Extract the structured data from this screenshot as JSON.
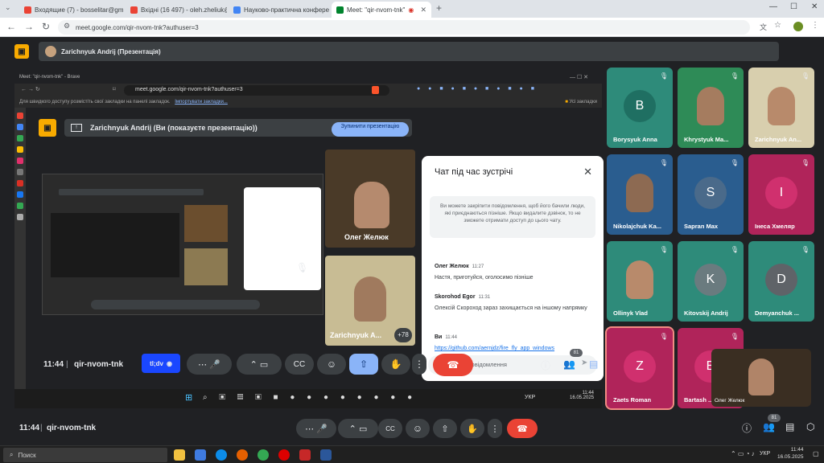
{
  "browser": {
    "tabs": [
      {
        "label": "Входящие (7) - bosselitar@gm"
      },
      {
        "label": "Вхідні (16 497) - oleh.zheliuk@"
      },
      {
        "label": "Науково-практична конфере"
      },
      {
        "label": "Meet: \"qir-nvom-tnk\""
      }
    ],
    "new_tab": "+",
    "url": "meet.google.com/qir-nvom-tnk?authuser=3"
  },
  "presenter_chip": "Zarichnyuk Andrij (Презентація)",
  "shared": {
    "window_title": "Meet: \"qir-nvom-tnk\" - Brave",
    "url": "meet.google.com/qir-nvom-tnk?authuser=3",
    "bookmarks_hint": "Для швидкого доступу розмістіть свої закладки на панелі закладок.",
    "bookmarks_link": "Імпортувати закладки...",
    "bookmarks_folder": "Усі закладки",
    "presenting_text": "Zarichnyuk Andrij (Ви (показуєте презентацію))",
    "stop_button": "Зупинити презентацію",
    "tile1_name": "Олег Желюк",
    "tile2_name": "Zarichnyuk A...",
    "tile2_more": "+78",
    "time": "11:44",
    "meeting_code": "qir-nvom-tnk",
    "tl_dv": "tl;dv",
    "people_count": "81",
    "tray_lang": "УКР",
    "tray_time": "11:44",
    "tray_date": "16.05.2025"
  },
  "chat": {
    "title": "Чат під час зустрічі",
    "note": "Ви можете закріпити повідомлення, щоб його бачили люди, які приєднаються пізніше. Якщо видалите дзвінок, то не зможете отримати доступ до цього чату.",
    "messages": [
      {
        "name": "Олег Желюк",
        "time": "11:27",
        "text": "Настя, приготуйся, оголосимо пізніше"
      },
      {
        "name": "Skorohod Egor",
        "time": "11:31",
        "text": "Олексій Скороход зараз захищається на іншому напрямку"
      },
      {
        "name": "Ви",
        "time": "11:44",
        "text": "https://github.com/aernjdz/fire_fly_app_windows"
      }
    ],
    "input_placeholder": "Надіслати повідомлення"
  },
  "tiles": [
    {
      "name": "Borysyuk Anna",
      "letter": "B",
      "bg": "#2e8b7a",
      "circle": "#1f6f62"
    },
    {
      "name": "Khrystyuk Ma...",
      "letter": "",
      "bg": "#2e8b57",
      "circle": ""
    },
    {
      "name": "Zarichnyuk An...",
      "letter": "",
      "bg": "#d8cfae",
      "circle": ""
    },
    {
      "name": "Nikolajchuk Ka...",
      "letter": "",
      "bg": "#2a5d8f",
      "circle": ""
    },
    {
      "name": "Sapran Max",
      "letter": "S",
      "bg": "#2a5d8f",
      "circle": "#4a6a8a"
    },
    {
      "name": "Інеса Хмеляр",
      "letter": "І",
      "bg": "#b0245a",
      "circle": "#d0306e"
    },
    {
      "name": "Ollinyk Vlad",
      "letter": "",
      "bg": "#2e8b7a",
      "circle": ""
    },
    {
      "name": "Kitovskij Andrij",
      "letter": "K",
      "bg": "#2e8b7a",
      "circle": "#6a7b7f"
    },
    {
      "name": "Demyanchuk ...",
      "letter": "D",
      "bg": "#2e8b7a",
      "circle": "#5f6368"
    },
    {
      "name": "Zaets Roman",
      "letter": "Z",
      "bg": "#b0245a",
      "circle": "#d0306e"
    },
    {
      "name": "Bartash ...",
      "letter": "B",
      "bg": "#b0245a",
      "circle": "#d0306e"
    }
  ],
  "self_view_name": "Олег Желюк",
  "bottom": {
    "time": "11:44",
    "meeting_code": "qir-nvom-tnk",
    "people_count": "81"
  },
  "taskbar": {
    "search_placeholder": "Поиск",
    "lang": "УКР",
    "time": "11:44",
    "date": "16.05.2025"
  },
  "colors": {
    "accent": "#8ab4f8",
    "end_call": "#ea4335",
    "logo": "#f9ab00"
  }
}
